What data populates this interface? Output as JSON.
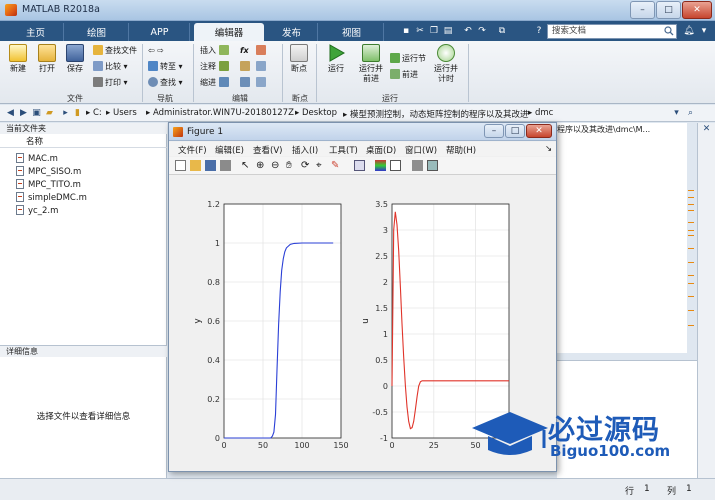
{
  "window": {
    "title": "MATLAB R2018a"
  },
  "tabs": [
    {
      "label": "主页"
    },
    {
      "label": "绘图"
    },
    {
      "label": "APP"
    },
    {
      "label": "编辑器"
    },
    {
      "label": "发布"
    },
    {
      "label": "视图"
    }
  ],
  "search": {
    "placeholder": "搜索文档"
  },
  "ribbon": {
    "file": {
      "new": "新建",
      "open": "打开",
      "save": "保存",
      "find_files": "查找文件",
      "compare": "比较",
      "print": "打印",
      "group": "文件"
    },
    "nav": {
      "goto": "转至",
      "find": "查找",
      "group": "导航"
    },
    "edit": {
      "insert": "插入",
      "comment": "注释",
      "indent": "缩进",
      "fx": "fx",
      "group": "编辑"
    },
    "breakpoint": {
      "label": "断点",
      "group": "断点"
    },
    "run": {
      "run": "运行",
      "run_advance_1": "运行并",
      "run_advance_2": "前进",
      "run_section": "运行节",
      "advance": "前进",
      "run_time_1": "运行并",
      "run_time_2": "计时",
      "group": "运行"
    }
  },
  "address": {
    "crumbs": [
      "C:",
      "Users",
      "Administrator.WIN7U-20180127Z",
      "Desktop",
      "模型预测控制，动态矩阵控制的程序以及其改进",
      "dmc"
    ]
  },
  "file_panel": {
    "title": "当前文件夹",
    "column": "名称",
    "files": [
      "MAC.m",
      "MPC_SISO.m",
      "MPC_TITO.m",
      "simpleDMC.m",
      "yc_2.m"
    ],
    "detail_title": "详细信息",
    "detail_msg": "选择文件以查看详细信息"
  },
  "command_path": "程序以及其改进\\dmc\\M...",
  "status": {
    "row_label": "行",
    "row": "1",
    "col_label": "列",
    "col": "1"
  },
  "figure": {
    "title": "Figure 1",
    "menus": [
      "文件(F)",
      "编辑(E)",
      "查看(V)",
      "插入(I)",
      "工具(T)",
      "桌面(D)",
      "窗口(W)",
      "帮助(H)"
    ]
  },
  "watermark": {
    "text": "必过源码",
    "url": "Biguo100.com"
  },
  "chart_data": [
    {
      "type": "line",
      "ylabel": "y",
      "xlim": [
        0,
        150
      ],
      "ylim": [
        0,
        1.2
      ],
      "x_ticks": [
        "0",
        "50",
        "100",
        "150"
      ],
      "y_ticks": [
        "0",
        "0.2",
        "0.4",
        "0.6",
        "0.8",
        "1",
        "1.2"
      ],
      "series": [
        {
          "color": "#2a3fd6",
          "x": [
            0,
            55,
            60,
            62,
            64,
            66,
            68,
            70,
            72,
            74,
            76,
            78,
            80,
            85,
            90,
            100,
            120,
            140
          ],
          "y": [
            0,
            0,
            0,
            0.01,
            0.03,
            0.12,
            0.35,
            0.58,
            0.75,
            0.86,
            0.92,
            0.955,
            0.975,
            0.993,
            0.998,
            1.0,
            1.0,
            1.0
          ]
        }
      ]
    },
    {
      "type": "line",
      "ylabel": "u",
      "xlim": [
        0,
        70
      ],
      "ylim": [
        -1,
        3.5
      ],
      "x_ticks": [
        "0",
        "25",
        "50"
      ],
      "y_ticks": [
        "-1",
        "-0.5",
        "0",
        "0.5",
        "1",
        "1.5",
        "2",
        "2.5",
        "3",
        "3.5"
      ],
      "series": [
        {
          "color": "#e0342a",
          "x": [
            0,
            1,
            2,
            3,
            4,
            5,
            6,
            7,
            8,
            9,
            10,
            11,
            12,
            13,
            14,
            15,
            16,
            17,
            18,
            20,
            22,
            25,
            30,
            40,
            50,
            70
          ],
          "y": [
            0,
            3.0,
            3.35,
            3.1,
            2.6,
            1.9,
            1.2,
            0.55,
            0.0,
            -0.4,
            -0.68,
            -0.82,
            -0.8,
            -0.68,
            -0.45,
            -0.2,
            0.0,
            0.08,
            0.1,
            0.1,
            0.1,
            0.1,
            0.1,
            0.1,
            0.1,
            0.1
          ]
        }
      ]
    }
  ]
}
